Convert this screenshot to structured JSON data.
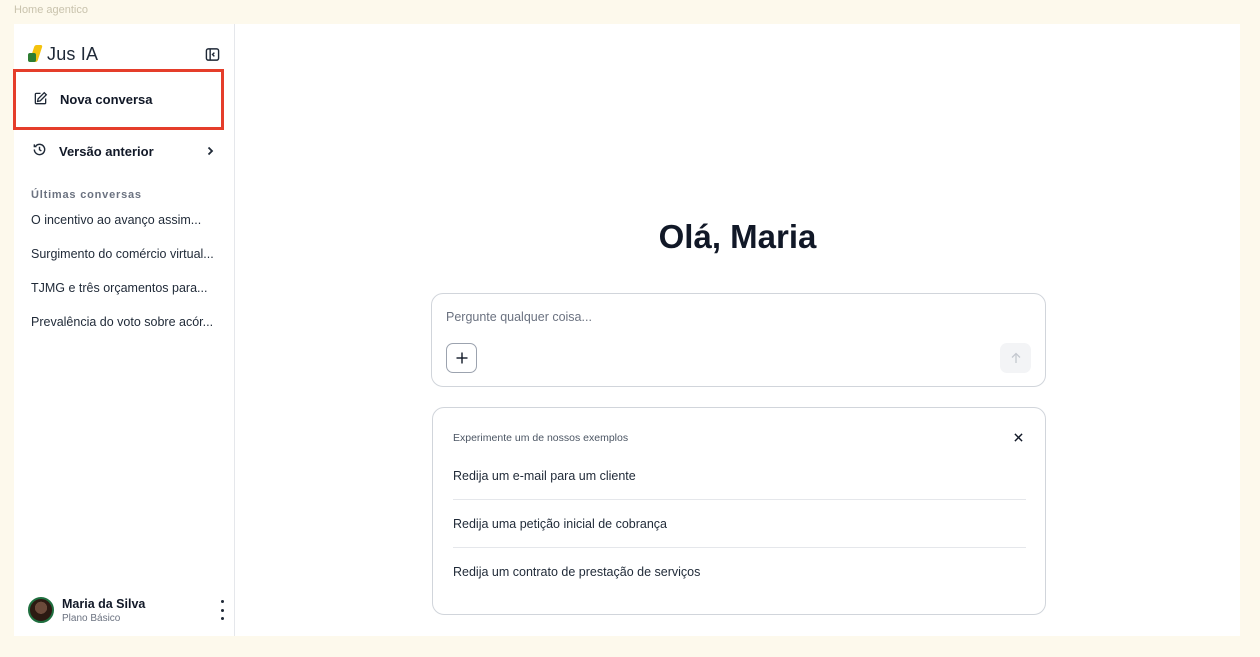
{
  "frame_label": "Home agentico",
  "brand": {
    "name": "Jus IA"
  },
  "sidebar": {
    "new_chat_label": "Nova conversa",
    "previous_version_label": "Versão anterior",
    "recent_title": "Últimas conversas",
    "conversations": [
      "O incentivo ao avanço assim...",
      "Surgimento do comércio virtual...",
      "TJMG e três orçamentos para...",
      "Prevalência do voto sobre acór..."
    ],
    "user": {
      "name": "Maria da Silva",
      "plan": "Plano Básico"
    }
  },
  "main": {
    "greeting": "Olá, Maria",
    "prompt_placeholder": "Pergunte qualquer coisa...",
    "examples": {
      "title": "Experimente um de nossos exemplos",
      "items": [
        "Redija um e-mail para um cliente",
        "Redija uma petição inicial de cobrança",
        "Redija um contrato de prestação de serviços"
      ]
    }
  },
  "colors": {
    "highlight": "#e53d2a",
    "background": "#fdf9ec",
    "logo_yellow": "#f4c20d",
    "logo_green": "#2e7d32"
  },
  "icons": [
    "sidebar-toggle-icon",
    "edit-icon",
    "history-icon",
    "chevron-right-icon",
    "plus-icon",
    "arrow-up-icon",
    "close-icon",
    "more-vertical-icon"
  ]
}
